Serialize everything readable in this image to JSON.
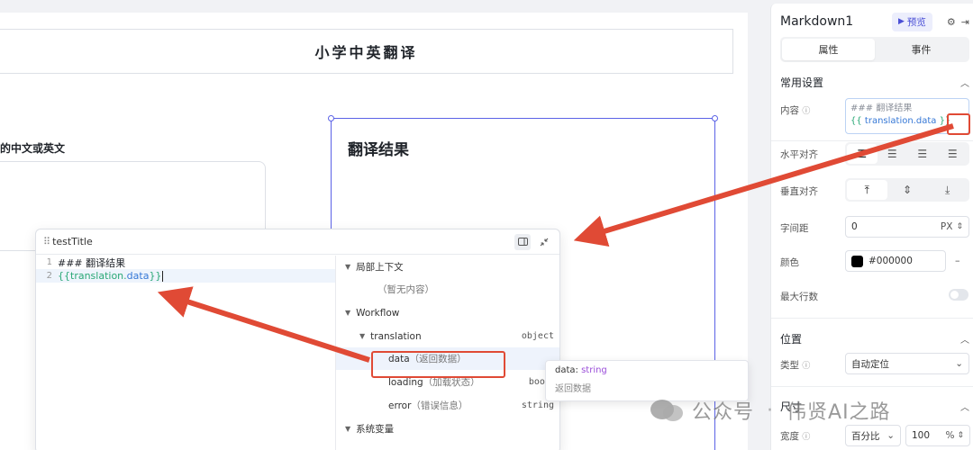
{
  "canvas": {
    "app_title": "小学中英翻译",
    "input_label": "的中文或英文",
    "markdown_heading": "翻译结果"
  },
  "editor": {
    "title": "testTitle",
    "code_lines": [
      {
        "num": "1",
        "text": "### 翻译结果"
      },
      {
        "num": "2",
        "brace_open": "{{ ",
        "obj": "translation.",
        "prop": "data",
        "brace_close": " }}"
      }
    ],
    "tree": {
      "local_context": "局部上下文",
      "empty": "（暂无内容）",
      "workflow": "Workflow",
      "translation": "translation",
      "translation_type": "object",
      "data": "data",
      "data_desc": "（返回数据）",
      "loading": "loading",
      "loading_desc": "（加载状态）",
      "loading_type": "boolea",
      "error": "error",
      "error_desc": "（错误信息）",
      "error_type": "string",
      "system_vars": "系统变量"
    }
  },
  "tooltip": {
    "name": "data: ",
    "type": "string",
    "desc": "返回数据"
  },
  "panel": {
    "component_name": "Markdown1",
    "preview_label": "预览",
    "tabs": [
      "属性",
      "事件"
    ],
    "section_common": "常用设置",
    "content_label": "内容",
    "content_line1": "### 翻译结果",
    "content_line2_open": "{{ ",
    "content_line2_var": "translation.data",
    "content_line2_close": " }}",
    "h_align_label": "水平对齐",
    "v_align_label": "垂直对齐",
    "letter_spacing_label": "字间距",
    "letter_spacing_value": "0",
    "letter_spacing_unit": "PX",
    "color_label": "颜色",
    "color_value": "#000000",
    "color_swatch": "#000000",
    "max_lines_label": "最大行数",
    "section_position": "位置",
    "type_label": "类型",
    "type_value": "自动定位",
    "section_size": "尺寸",
    "width_label": "宽度",
    "width_mode": "百分比",
    "width_value": "100",
    "width_unit": "%"
  },
  "watermark": {
    "account": "公众号",
    "author": "伟贤AI之路"
  },
  "colors": {
    "accent": "#5b62e6",
    "annotation": "#e04a35",
    "var_green": "#2aa876",
    "var_blue": "#3678d6"
  }
}
